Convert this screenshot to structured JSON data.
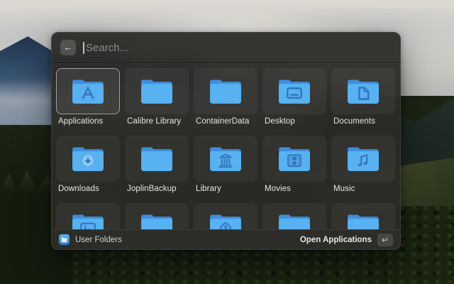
{
  "search": {
    "placeholder": "Search...",
    "back_icon": "←"
  },
  "folders": [
    {
      "label": "Applications",
      "icon": "applications",
      "selected": true
    },
    {
      "label": "Calibre Library",
      "icon": "plain"
    },
    {
      "label": "ContainerData",
      "icon": "plain"
    },
    {
      "label": "Desktop",
      "icon": "desktop"
    },
    {
      "label": "Documents",
      "icon": "documents"
    },
    {
      "label": "Downloads",
      "icon": "downloads"
    },
    {
      "label": "JoplinBackup",
      "icon": "plain"
    },
    {
      "label": "Library",
      "icon": "library"
    },
    {
      "label": "Movies",
      "icon": "movies"
    },
    {
      "label": "Music",
      "icon": "music"
    },
    {
      "label": "",
      "icon": "pictures"
    },
    {
      "label": "",
      "icon": "plain"
    },
    {
      "label": "",
      "icon": "public"
    },
    {
      "label": "",
      "icon": "plain"
    },
    {
      "label": "",
      "icon": "plain"
    }
  ],
  "footer": {
    "source_label": "User Folders",
    "action_label": "Open Applications",
    "key_hint": "↵"
  },
  "colors": {
    "folder_front": "#58B1F1",
    "folder_back": "#3E8EDC",
    "folder_glyph": "#3277BD",
    "accent_blue": "#3E8EDC"
  }
}
